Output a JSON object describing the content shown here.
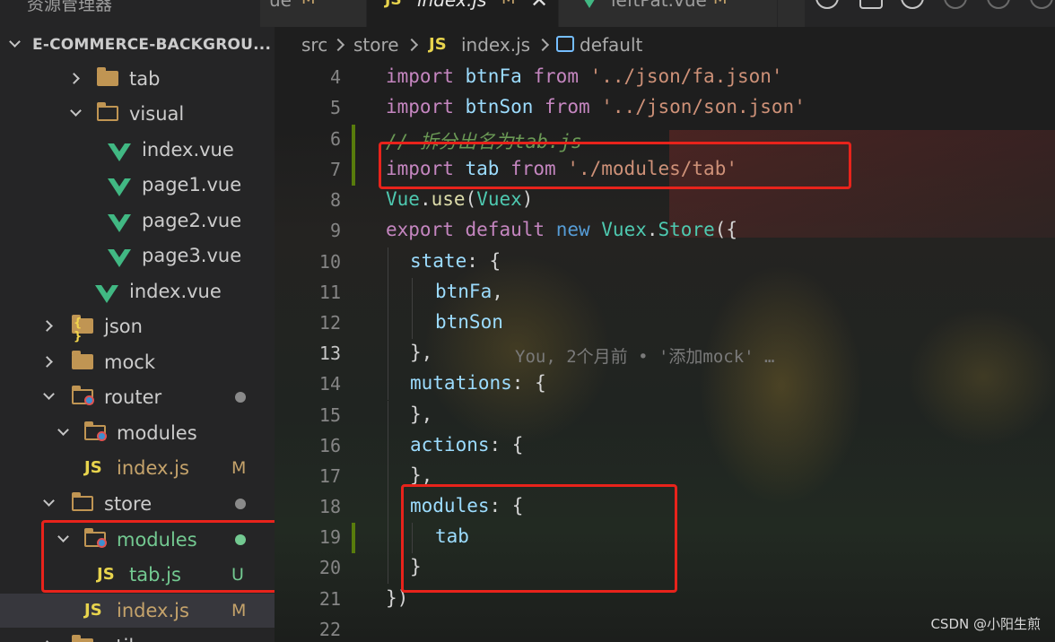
{
  "sidebar_title": "资源管理器",
  "editor_tabs": [
    {
      "label": "ue",
      "status": "M",
      "icon": "vue-icon"
    },
    {
      "label": "index.js",
      "status": "M",
      "icon": "js-icon",
      "active": true
    },
    {
      "label": "leftPat.vue",
      "status": "M",
      "icon": "vue-icon"
    }
  ],
  "close_glyph": "✕",
  "project": "E-COMMERCE-BACKGROU...",
  "tree": [
    {
      "label": "tab",
      "icon": "folder-icon"
    },
    {
      "label": "visual",
      "icon": "folder-open-icon"
    },
    {
      "label": "index.vue",
      "icon": "vue-icon"
    },
    {
      "label": "page1.vue",
      "icon": "vue-icon"
    },
    {
      "label": "page2.vue",
      "icon": "vue-icon"
    },
    {
      "label": "page3.vue",
      "icon": "vue-icon"
    },
    {
      "label": "index.vue",
      "icon": "vue-icon"
    },
    {
      "label": "json",
      "icon": "folder-json-icon"
    },
    {
      "label": "mock",
      "icon": "folder-icon"
    },
    {
      "label": "router",
      "icon": "folder-router-icon"
    },
    {
      "label": "modules",
      "icon": "folder-modules-icon"
    },
    {
      "label": "index.js",
      "icon": "js-icon",
      "status": "M"
    },
    {
      "label": "store",
      "icon": "folder-open-icon"
    },
    {
      "label": "modules",
      "icon": "folder-modules-icon"
    },
    {
      "label": "tab.js",
      "icon": "js-icon",
      "status": "U"
    },
    {
      "label": "index.js",
      "icon": "js-icon",
      "status": "M"
    },
    {
      "label": "util",
      "icon": "folder-icon"
    }
  ],
  "breadcrumb": [
    "src",
    "store",
    "index.js",
    "default"
  ],
  "js_glyph": "JS",
  "code": {
    "line_numbers": [
      "4",
      "5",
      "6",
      "7",
      "8",
      "9",
      "10",
      "11",
      "12",
      "13",
      "14",
      "15",
      "16",
      "17",
      "18",
      "19",
      "20",
      "21",
      "22"
    ],
    "l4": [
      "import",
      "btnFa",
      "from",
      "'../json/fa.json'"
    ],
    "l5": [
      "import",
      "btnSon",
      "from",
      "'../json/son.json'"
    ],
    "l6": "// 拆分出名为tab.js",
    "l7": [
      "import",
      "tab",
      "from",
      "'./modules/tab'"
    ],
    "l8": [
      "Vue",
      ".",
      "use",
      "(",
      "Vuex",
      ")"
    ],
    "l9": [
      "export",
      "default",
      "new",
      "Vuex",
      ".",
      "Store",
      "({"
    ],
    "l10": [
      "state",
      ": {"
    ],
    "l11": [
      "btnFa",
      ","
    ],
    "l12": "btnSon",
    "l13": "},",
    "blame": "You, 2个月前 • '添加mock' …",
    "l14": [
      "mutations",
      ": {"
    ],
    "l15": "},",
    "l16": [
      "actions",
      ": {"
    ],
    "l17": "},",
    "l18": [
      "modules",
      ": {"
    ],
    "l19": "tab",
    "l20": "}",
    "l21": "})",
    "l22": ""
  },
  "watermark": "CSDN @小阳生煎"
}
